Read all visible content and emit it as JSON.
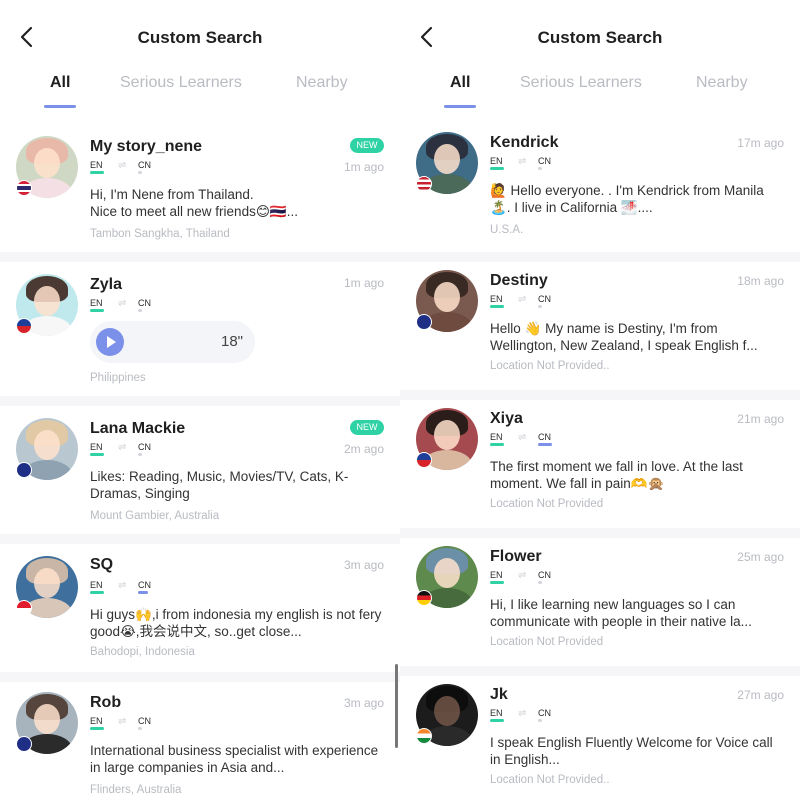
{
  "screens": [
    {
      "header": {
        "title": "Custom Search",
        "back_icon": "chevron-left-icon"
      },
      "tabs": [
        {
          "label": "All",
          "active": true
        },
        {
          "label": "Serious Learners",
          "active": false
        },
        {
          "label": "Nearby",
          "active": false
        }
      ],
      "users": [
        {
          "name": "My story_nene",
          "badge": "NEW",
          "time": "1m ago",
          "lang_from": "EN",
          "lang_to": "CN",
          "bio": "Hi, I'm Nene from Thailand.\n   Nice to meet all new friends😊🇹🇭...",
          "location": "Tambon Sangkha, Thailand",
          "flag": "thailand"
        },
        {
          "name": "Zyla",
          "badge": "",
          "time": "1m ago",
          "lang_from": "EN",
          "lang_to": "CN",
          "voice_duration": "18\"",
          "location": "Philippines",
          "flag": "philippines"
        },
        {
          "name": "Lana Mackie",
          "badge": "NEW",
          "time": "2m ago",
          "lang_from": "EN",
          "lang_to": "CN",
          "bio": "Likes: Reading, Music, Movies/TV, Cats, K-Dramas, Singing",
          "location": "Mount Gambier, Australia",
          "flag": "australia"
        },
        {
          "name": "SQ",
          "badge": "",
          "time": "3m ago",
          "lang_from": "EN",
          "lang_to": "CN",
          "bio": "Hi guys🙌,i from indonesia my english is not fery good😭,我会说中文, so..get close...",
          "location": "Bahodopi, Indonesia",
          "flag": "indonesia"
        },
        {
          "name": "Rob",
          "badge": "",
          "time": "3m ago",
          "lang_from": "EN",
          "lang_to": "CN",
          "bio": "International business specialist with experience in large companies in Asia and...",
          "location": "Flinders, Australia",
          "flag": "australia"
        }
      ]
    },
    {
      "header": {
        "title": "Custom Search",
        "back_icon": "chevron-left-icon"
      },
      "tabs": [
        {
          "label": "All",
          "active": true
        },
        {
          "label": "Serious Learners",
          "active": false
        },
        {
          "label": "Nearby",
          "active": false
        }
      ],
      "users": [
        {
          "name": "Kendrick",
          "badge": "",
          "time": "17m ago",
          "lang_from": "EN",
          "lang_to": "CN",
          "bio": "🙋 Hello everyone.  . I'm Kendrick from Manila 🏝️. I live in California 🌁....",
          "location": "U.S.A.",
          "flag": "usa"
        },
        {
          "name": "Destiny",
          "badge": "",
          "time": "18m ago",
          "lang_from": "EN",
          "lang_to": "CN",
          "bio": "Hello 👋 My name is Destiny, I'm from Wellington, New Zealand, I speak English f...",
          "location": "Location Not Provided..",
          "flag": "new-zealand"
        },
        {
          "name": "Xiya",
          "badge": "",
          "time": "21m ago",
          "lang_from": "EN",
          "lang_to": "CN",
          "bio": "The first moment we fall in love. At the last moment. We fall in pain🫶🙊",
          "location": "Location Not Provided",
          "flag": "philippines"
        },
        {
          "name": "Flower",
          "badge": "",
          "time": "25m ago",
          "lang_from": "EN",
          "lang_to": "CN",
          "bio": "Hi, I like learning new languages so I can communicate with people in their native la...",
          "location": "Location Not Provided",
          "flag": "germany"
        },
        {
          "name": "Jk",
          "badge": "",
          "time": "27m ago",
          "lang_from": "EN",
          "lang_to": "CN",
          "bio": "I speak English Fluently Welcome for Voice call in English...",
          "location": "Location Not Provided..",
          "flag": "india"
        }
      ]
    }
  ],
  "colors": {
    "accent": "#7b90e8",
    "new_badge": "#2fd2a4",
    "muted_text": "#b8bbc1",
    "lang_en_bar": "#2fd2a4",
    "lang_cn_bar_blue": "#7b90e8",
    "lang_cn_bar_gray": "#d5d7dc"
  }
}
